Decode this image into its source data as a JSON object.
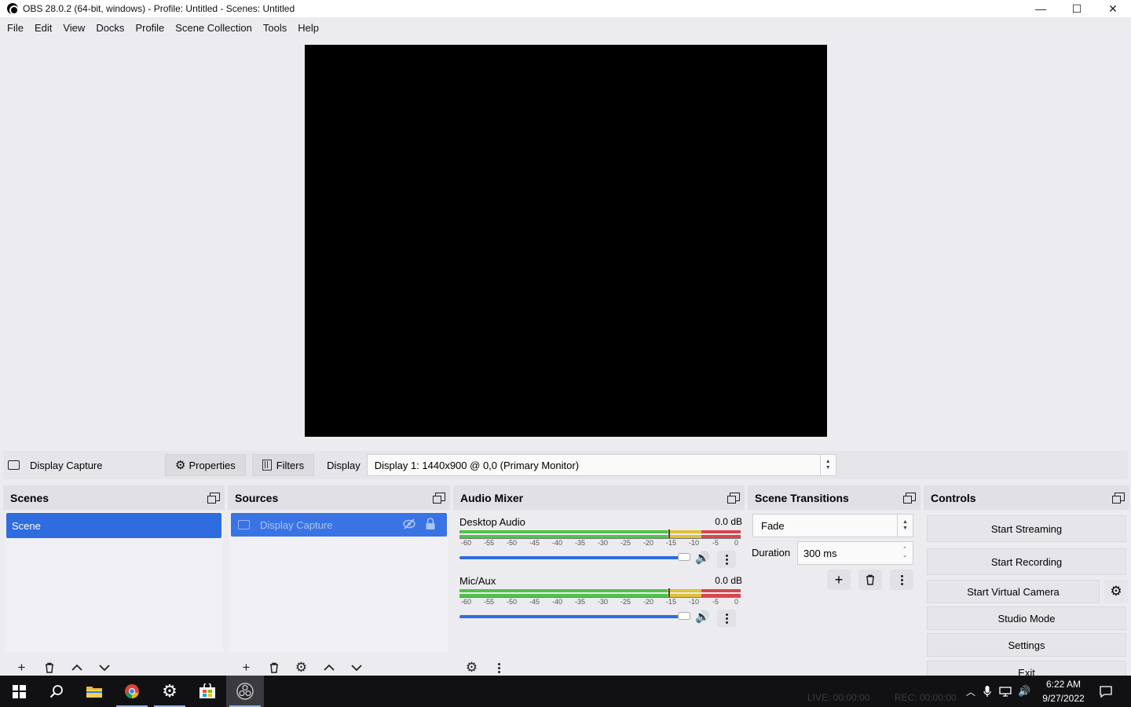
{
  "window": {
    "title": "OBS 28.0.2 (64-bit, windows) - Profile: Untitled - Scenes: Untitled",
    "minimize": "—",
    "maximize": "☐",
    "close": "✕"
  },
  "menu": [
    "File",
    "Edit",
    "View",
    "Docks",
    "Profile",
    "Scene Collection",
    "Tools",
    "Help"
  ],
  "source_toolbar": {
    "source_name": "Display Capture",
    "properties_label": "Properties",
    "filters_label": "Filters",
    "display_label": "Display",
    "display_value": "Display 1: 1440x900 @ 0,0 (Primary Monitor)"
  },
  "scenes": {
    "title": "Scenes",
    "items": [
      "Scene"
    ]
  },
  "sources": {
    "title": "Sources",
    "items": [
      "Display Capture"
    ]
  },
  "audio_mixer": {
    "title": "Audio Mixer",
    "channels": [
      {
        "name": "Desktop Audio",
        "db": "0.0 dB",
        "volume": 1.0
      },
      {
        "name": "Mic/Aux",
        "db": "0.0 dB",
        "volume": 1.0
      }
    ],
    "scale": [
      "-60",
      "-55",
      "-50",
      "-45",
      "-40",
      "-35",
      "-30",
      "-25",
      "-20",
      "-15",
      "-10",
      "-5",
      "0"
    ]
  },
  "scene_transitions": {
    "title": "Scene Transitions",
    "transition": "Fade",
    "duration_label": "Duration",
    "duration_value": "300 ms"
  },
  "controls": {
    "title": "Controls",
    "start_streaming": "Start Streaming",
    "start_recording": "Start Recording",
    "start_virtual_camera": "Start Virtual Camera",
    "studio_mode": "Studio Mode",
    "settings": "Settings",
    "exit": "Exit"
  },
  "status": {
    "live": "LIVE: 00:00:00",
    "rec": "REC: 00:00:00"
  },
  "taskbar": {
    "time": "6:22 AM",
    "date": "9/27/2022"
  },
  "colors": {
    "accent": "#2f6ce0",
    "meter_green": "#51c24a",
    "meter_yellow": "#dfc239",
    "meter_red": "#d9454e"
  }
}
